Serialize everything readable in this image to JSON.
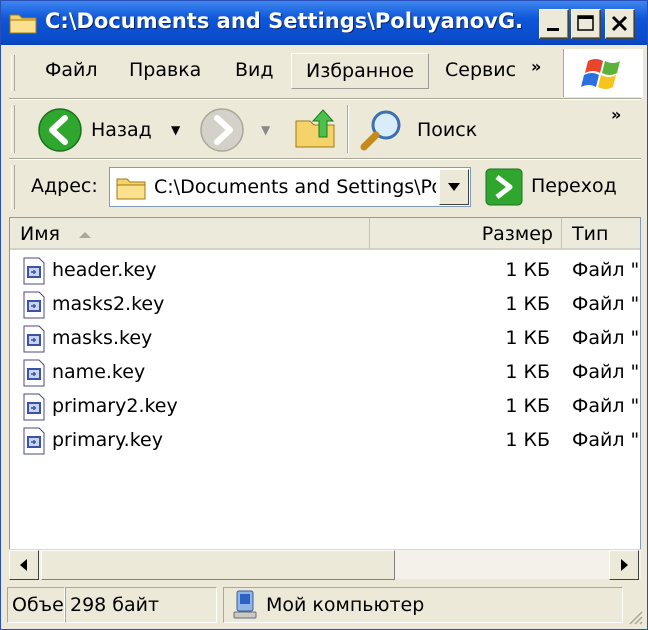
{
  "window": {
    "title": "C:\\Documents and Settings\\PoluyanovG...",
    "controls": [
      "minimize",
      "maximize",
      "close"
    ]
  },
  "menu": {
    "items": [
      "Файл",
      "Правка",
      "Вид",
      "Избранное",
      "Сервис"
    ],
    "selected": "Избранное",
    "overflow": "»"
  },
  "toolbar": {
    "back_label": "Назад",
    "search_label": "Поиск",
    "overflow": "»"
  },
  "address": {
    "label": "Адрес:",
    "value": "C:\\Documents and Settings\\Po",
    "go_label": "Переход"
  },
  "list": {
    "columns": [
      "Имя",
      "Размер",
      "Тип"
    ],
    "sort_column": "Имя",
    "rows": [
      {
        "name": "header.key",
        "size": "1 КБ",
        "type": "Файл \"I"
      },
      {
        "name": "masks2.key",
        "size": "1 КБ",
        "type": "Файл \"I"
      },
      {
        "name": "masks.key",
        "size": "1 КБ",
        "type": "Файл \"I"
      },
      {
        "name": "name.key",
        "size": "1 КБ",
        "type": "Файл \"I"
      },
      {
        "name": "primary2.key",
        "size": "1 КБ",
        "type": "Файл \"I"
      },
      {
        "name": "primary.key",
        "size": "1 КБ",
        "type": "Файл \"I"
      }
    ]
  },
  "status": {
    "objects": "Объе",
    "size": "298 байт",
    "location": "Мой компьютер"
  },
  "colors": {
    "titlebar": "#0a4ccc",
    "chrome": "#ece9d8",
    "back_button": "#2fa72f",
    "go_button": "#2fa72f"
  }
}
